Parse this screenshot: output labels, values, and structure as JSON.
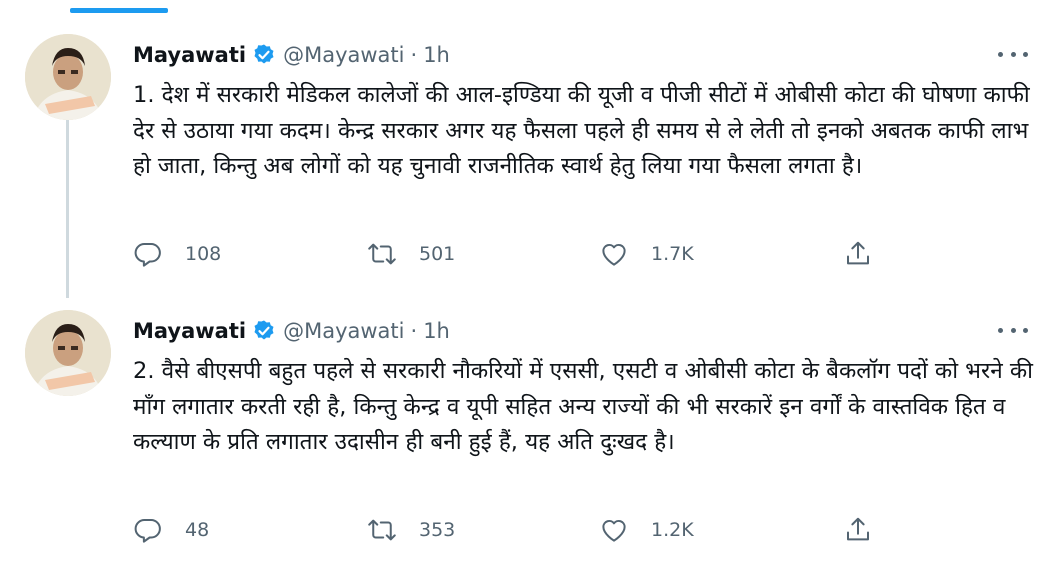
{
  "tweets": [
    {
      "author_name": "Mayawati",
      "handle": "@Mayawati",
      "separator": "·",
      "time": "1h",
      "text": "1. देश में सरकारी मेडिकल कालेजों की आल-इण्डिया की यूजी व पीजी सीटों में ओबीसी कोटा की घोषणा काफी देर से उठाया गया कदम। केन्द्र सरकार अगर यह फैसला पहले ही समय से ले लेती तो इनको अबतक काफी लाभ हो जाता, किन्तु अब लोगों को यह चुनावी राजनीतिक स्वार्थ हेतु लिया गया फैसला लगता है।",
      "replies": "108",
      "retweets": "501",
      "likes": "1.7K"
    },
    {
      "author_name": "Mayawati",
      "handle": "@Mayawati",
      "separator": "·",
      "time": "1h",
      "text": "2. वैसे बीएसपी बहुत पहले से सरकारी नौकरियों में एससी, एसटी व ओबीसी कोटा के बैकलॉग पदों को भरने की माँग लगातार करती रही है, किन्तु केन्द्र व यूपी सहित अन्य राज्यों की भी सरकारें इन वर्गों के वास्तविक हित व कल्याण के प्रति लगातार उदासीन ही बनी हुई हैं, यह अति दुःखद है।",
      "replies": "48",
      "retweets": "353",
      "likes": "1.2K"
    }
  ],
  "icons": {
    "verified": "verified-badge-icon",
    "more": "more-options-icon",
    "reply": "reply-icon",
    "retweet": "retweet-icon",
    "like": "heart-icon",
    "share": "share-icon"
  },
  "colors": {
    "accent": "#1d9bf0",
    "text": "#0f1419",
    "secondary": "#536471",
    "thread_line": "#cfd9de"
  }
}
